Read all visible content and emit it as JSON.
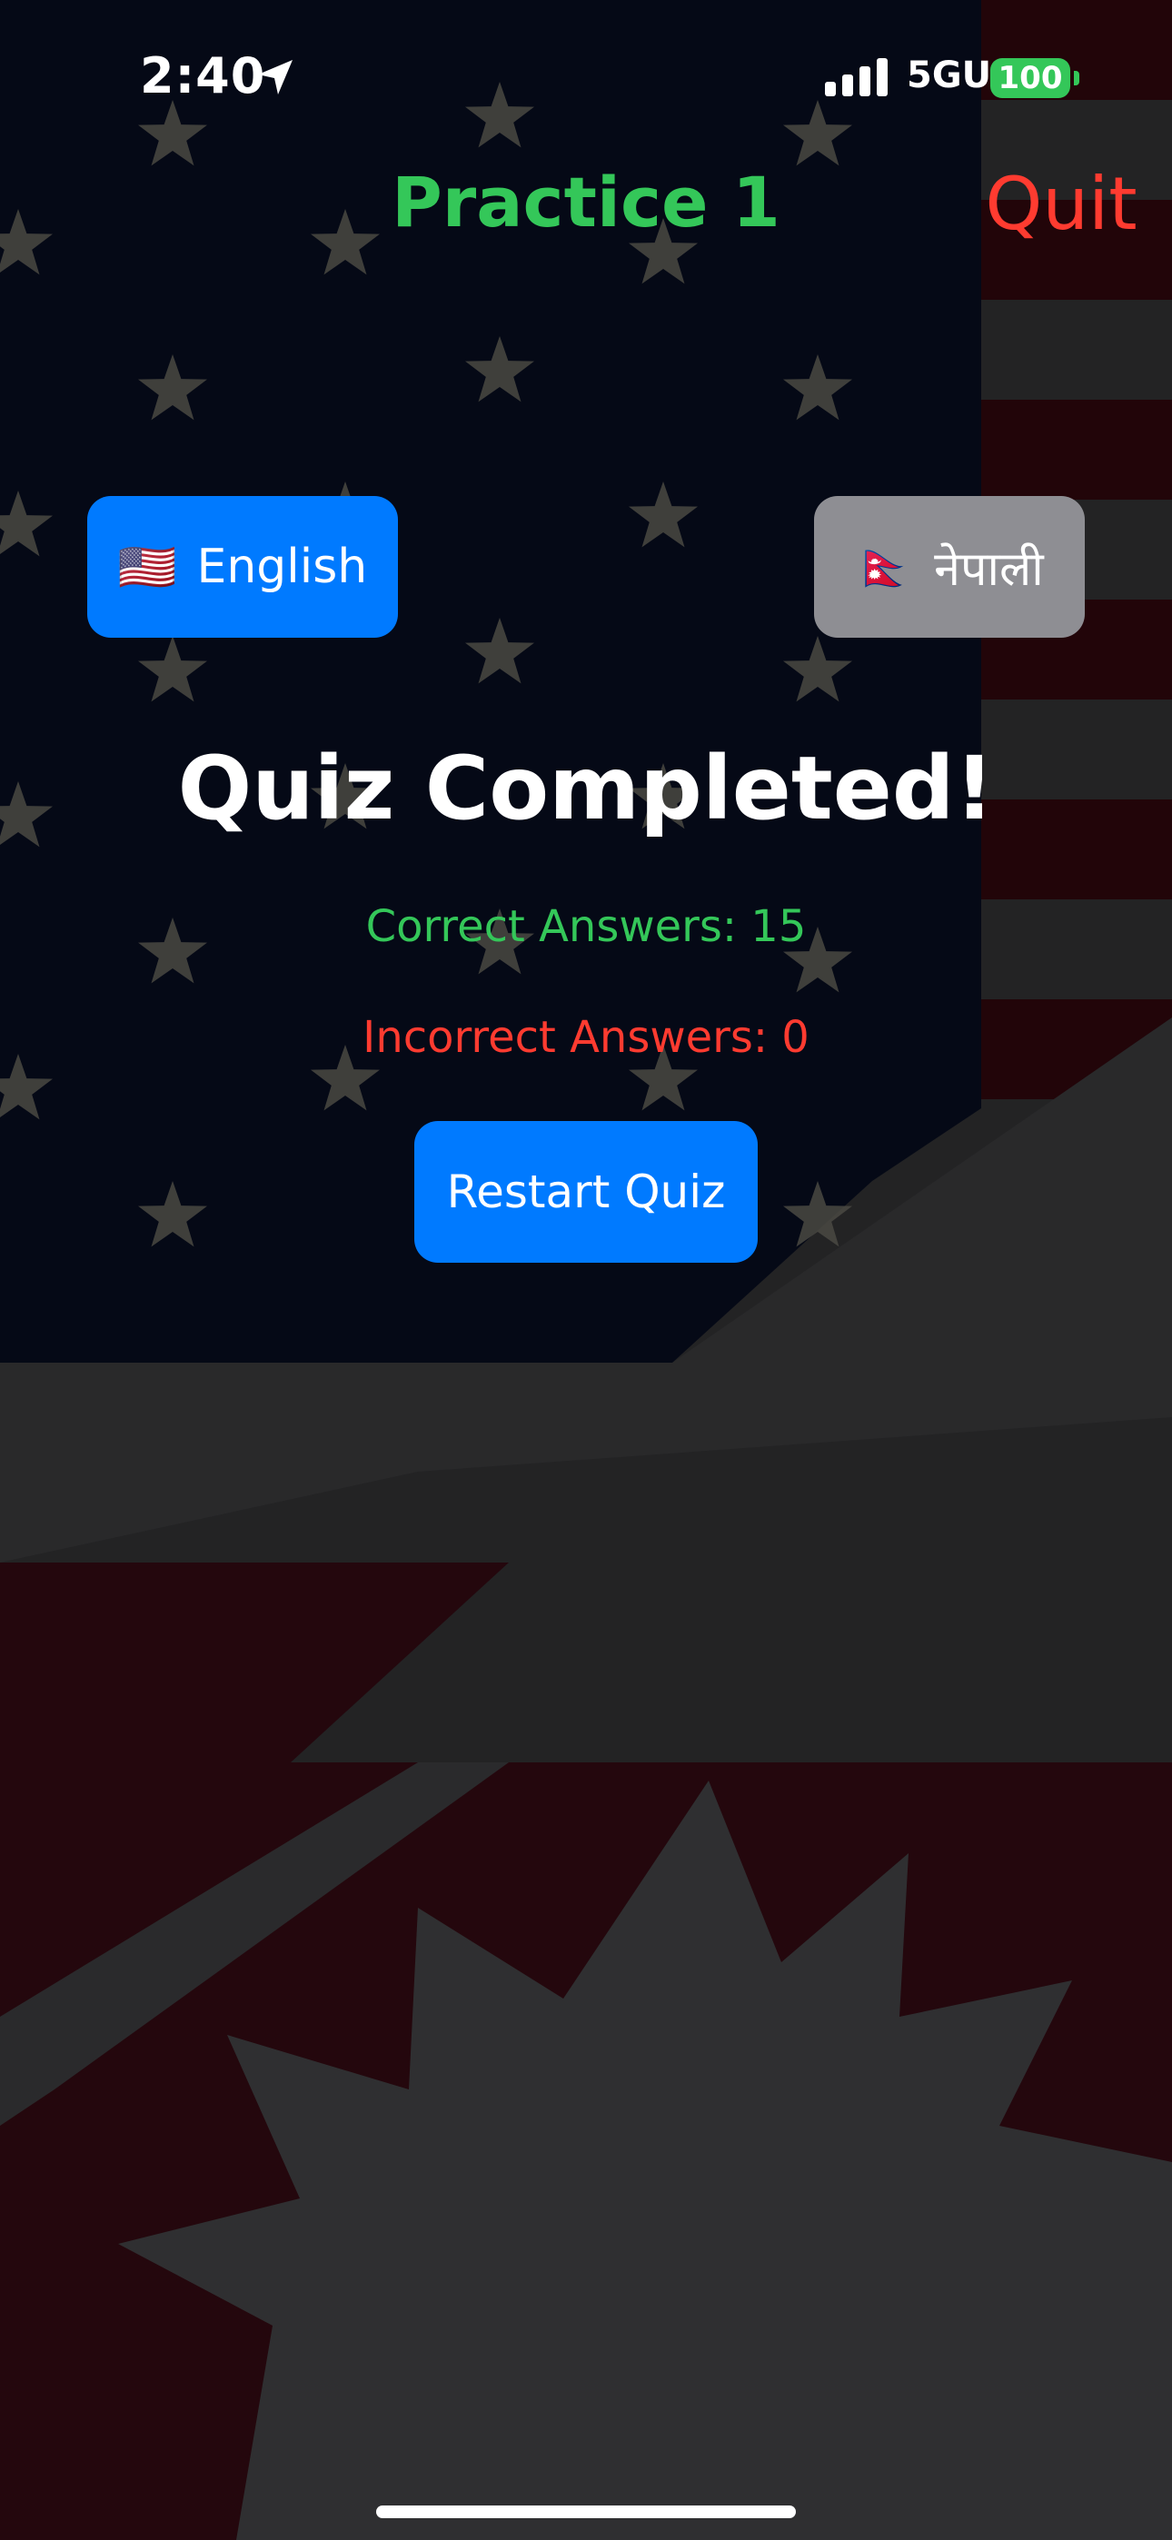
{
  "status_bar": {
    "time": "2:40",
    "network": "5GUC",
    "battery": "100",
    "icons": [
      "location-arrow-icon",
      "signal-bars-icon",
      "battery-icon"
    ]
  },
  "nav": {
    "title": "Practice 1",
    "quit_label": "Quit"
  },
  "language_toggle": {
    "english": {
      "flag": "🇺🇸",
      "label": "English",
      "selected": true
    },
    "nepali": {
      "flag": "🇳🇵",
      "label": "नेपाली",
      "selected": false
    }
  },
  "result": {
    "title": "Quiz Completed!",
    "correct_text": "Correct Answers: 15",
    "incorrect_text": "Incorrect Answers: 0",
    "correct_count": 15,
    "incorrect_count": 0,
    "restart_label": "Restart Quiz"
  },
  "background": {
    "description_colors": {
      "navy": "#0a1228",
      "red": "#3a0a12",
      "white": "#3a3a3c"
    }
  },
  "colors": {
    "accent_blue": "#007aff",
    "success_green": "#34c759",
    "danger_red": "#ff3b30",
    "neutral_gray": "#8e8e93"
  }
}
